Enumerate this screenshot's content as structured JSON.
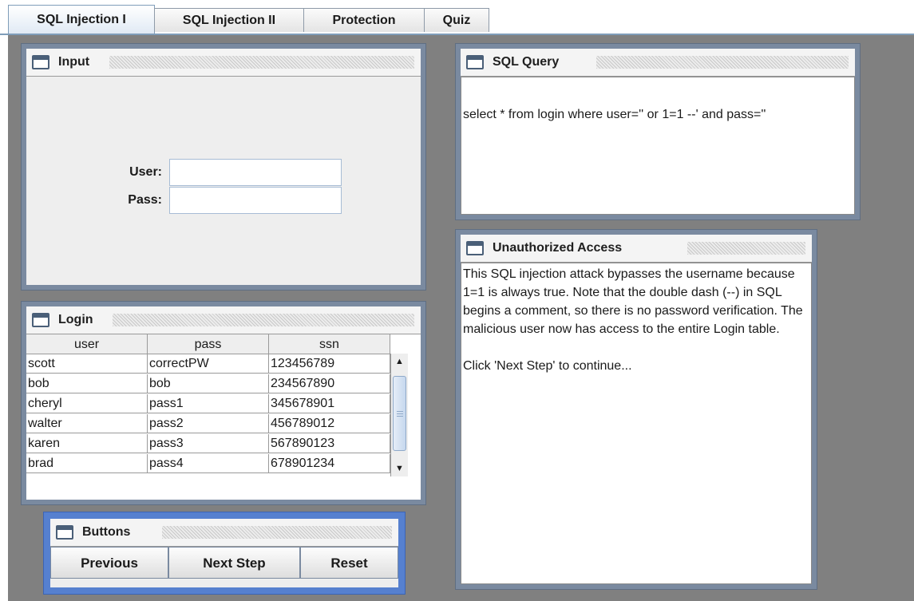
{
  "tabs": [
    {
      "label": "SQL Injection I",
      "active": true
    },
    {
      "label": "SQL Injection II",
      "active": false
    },
    {
      "label": "Protection",
      "active": false
    },
    {
      "label": "Quiz",
      "active": false
    }
  ],
  "input_frame": {
    "title": "Input",
    "user_label": "User:",
    "pass_label": "Pass:",
    "user_value": "",
    "pass_value": ""
  },
  "login_frame": {
    "title": "Login",
    "columns": [
      "user",
      "pass",
      "ssn"
    ],
    "rows": [
      [
        "scott",
        "correctPW",
        "123456789"
      ],
      [
        "bob",
        "bob",
        "234567890"
      ],
      [
        "cheryl",
        "pass1",
        "345678901"
      ],
      [
        "walter",
        "pass2",
        "456789012"
      ],
      [
        "karen",
        "pass3",
        "567890123"
      ],
      [
        "brad",
        "pass4",
        "678901234"
      ]
    ]
  },
  "buttons_frame": {
    "title": "Buttons",
    "previous": "Previous",
    "next": "Next Step",
    "reset": "Reset"
  },
  "sql_frame": {
    "title": "SQL Query",
    "query": "select * from login where user='' or 1=1 --' and pass=''"
  },
  "access_frame": {
    "title": "Unauthorized Access",
    "explanation": "This SQL injection attack bypasses the username because 1=1 is always true. Note that the double dash (--) in SQL begins a comment, so there is no password verification.  The malicious user now has access to the entire Login table.",
    "instruction": "Click 'Next Step' to continue..."
  },
  "icons": {
    "frame": "window-icon",
    "scroll_up": "arrow-up-icon",
    "scroll_down": "arrow-down-icon"
  },
  "colors": {
    "desktop": "#808080",
    "frame_border": "#7a8aa0",
    "selected_frame": "#5680cf",
    "tab_border": "#7f9db9"
  }
}
